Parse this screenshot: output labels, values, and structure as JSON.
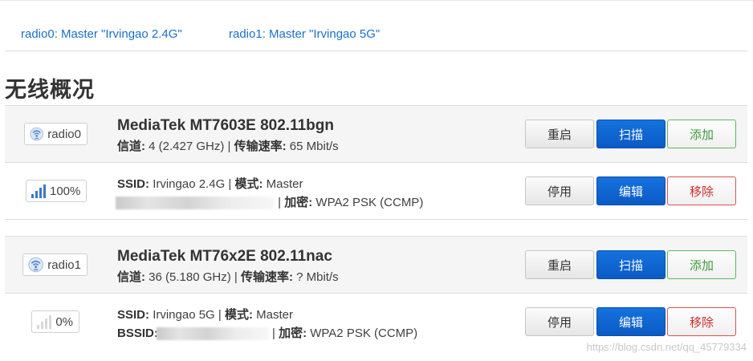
{
  "tabs": [
    {
      "label": "radio0: Master \"Irvingao 2.4G\""
    },
    {
      "label": "radio1: Master \"Irvingao 5G\""
    }
  ],
  "page_title": "无线概况",
  "labels": {
    "channel": "信道:",
    "bitrate": "传输速率:",
    "ssid": "SSID:",
    "mode": "模式:",
    "encryption": "加密:"
  },
  "devices": [
    {
      "badge": "radio0",
      "name": "MediaTek MT7603E 802.11bgn",
      "channel": "4 (2.427 GHz)",
      "bitrate": "65 Mbit/s",
      "buttons": {
        "restart": "重启",
        "scan": "扫描",
        "add": "添加"
      },
      "network": {
        "signal_badge": "100%",
        "signal_level": 1.0,
        "ssid": "Irvingao 2.4G",
        "mode": "Master",
        "encryption": "WPA2 PSK (CCMP)",
        "buttons": {
          "disable": "停用",
          "edit": "编辑",
          "remove": "移除"
        }
      }
    },
    {
      "badge": "radio1",
      "name": "MediaTek MT76x2E 802.11nac",
      "channel": "36 (5.180 GHz)",
      "bitrate": "? Mbit/s",
      "buttons": {
        "restart": "重启",
        "scan": "扫描",
        "add": "添加"
      },
      "network": {
        "signal_badge": "0%",
        "signal_level": 0.0,
        "ssid": "Irvingao 5G",
        "mode": "Master",
        "bssid_label": "BSSID:",
        "encryption": "WPA2 PSK (CCMP)",
        "buttons": {
          "disable": "停用",
          "edit": "编辑",
          "remove": "移除"
        }
      }
    }
  ],
  "watermark": "https://blog.csdn.net/qq_45779334",
  "colors": {
    "link": "#1a6fc9",
    "primary": "#0b5ac4",
    "add": "#3e9a3e",
    "remove": "#c9302c",
    "signal": "#3a78c9"
  },
  "icons": {
    "radio": "wifi-radio-icon",
    "signal": "signal-bars-icon"
  }
}
